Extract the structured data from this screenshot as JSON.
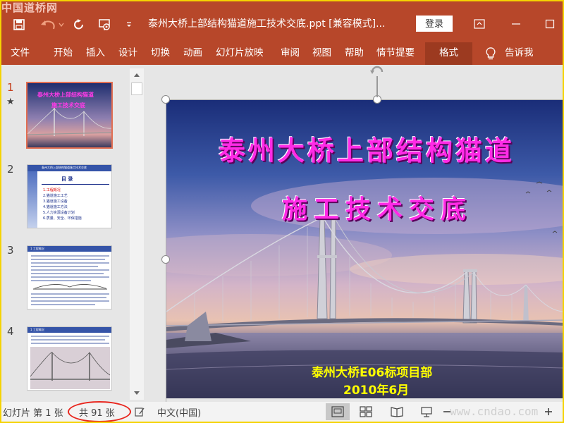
{
  "watermark": "中国道桥网",
  "window": {
    "title": "泰州大桥上部结构猫道施工技术交底.ppt [兼容模式]...",
    "login_label": "登录"
  },
  "ribbon": {
    "tabs": [
      "文件",
      "开始",
      "插入",
      "设计",
      "切换",
      "动画",
      "幻灯片放映",
      "审阅",
      "视图",
      "帮助",
      "情节提要",
      "格式"
    ],
    "active_tab": "格式",
    "tell_me": "告诉我"
  },
  "thumbnails": [
    {
      "number": "1",
      "star": "★",
      "title": "泰州大桥上部结构猫道",
      "subtitle": "施工技术交底"
    },
    {
      "number": "2",
      "heading": "泰州大桥上部结构猫道施工技术交底",
      "title": "目  录",
      "items": [
        "1.工程概况",
        "2.猫道施工工艺",
        "3.猫道施工设备",
        "4.猫道施工方法",
        "5.人力资源设备计划",
        "6.质量、安全、环保措施"
      ]
    },
    {
      "number": "3",
      "heading": "1 工程概况"
    },
    {
      "number": "4",
      "heading": "1 工程概况"
    }
  ],
  "slide": {
    "title_line1": "泰州大桥上部结构猫道",
    "title_line2": "施工技术交底",
    "subtitle_line1": "泰州大桥E06标项目部",
    "subtitle_line2": "2010年6月"
  },
  "status": {
    "slide_info": "幻灯片 第 1 张",
    "total": "共 91 张",
    "language": "中文(中国)",
    "watermark": "www.cndao.com"
  },
  "colors": {
    "ribbon": "#b7472a",
    "title_text": "#ff2be6",
    "subtitle_text": "#ffff00",
    "highlight_ellipse": "#e8261e"
  }
}
